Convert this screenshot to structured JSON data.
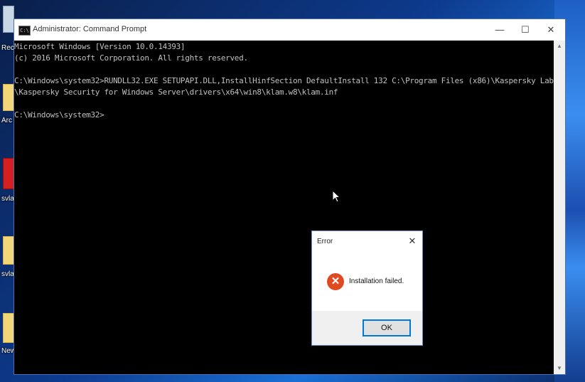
{
  "desktop": {
    "icons": [
      {
        "label": "Recy",
        "kind": "recycle"
      },
      {
        "label": "Arc",
        "kind": "folder"
      },
      {
        "label": "svla-",
        "kind": "red"
      },
      {
        "label": "svla-",
        "kind": "folder"
      },
      {
        "label": "New",
        "kind": "folder"
      }
    ]
  },
  "cmd_window": {
    "title": "Administrator: Command Prompt",
    "icon_glyph": "C:\\",
    "buttons": {
      "minimize": "—",
      "maximize": "☐",
      "close": "✕"
    },
    "lines": [
      "Microsoft Windows [Version 10.0.14393]",
      "(c) 2016 Microsoft Corporation. All rights reserved.",
      "",
      "C:\\Windows\\system32>RUNDLL32.EXE SETUPAPI.DLL,InstallHinfSection DefaultInstall 132 C:\\Program Files (x86)\\Kaspersky Lab",
      "\\Kaspersky Security for Windows Server\\drivers\\x64\\win8\\klam.w8\\klam.inf",
      "",
      "C:\\Windows\\system32>"
    ]
  },
  "error_dialog": {
    "title": "Error",
    "close_glyph": "✕",
    "icon_glyph": "✕",
    "message": "Installation failed.",
    "ok_label": "OK"
  }
}
